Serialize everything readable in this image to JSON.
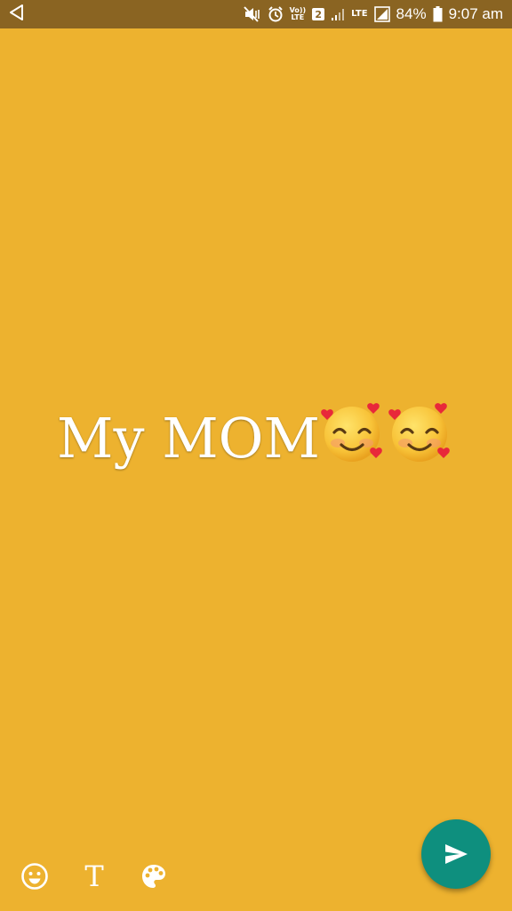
{
  "status_bar": {
    "battery_percent": "84%",
    "battery_level": 84,
    "time": "9:07 am",
    "volte_top": "Vo))",
    "volte_bottom": "LTE",
    "sim_slot": "2",
    "lte_label": "LTE",
    "icons": [
      "back-arrow-icon",
      "mute-vibrate-icon",
      "alarm-icon",
      "volte-icon",
      "sim-2-badge",
      "signal-icon",
      "lte-icon",
      "signal-icon",
      "battery-icon"
    ]
  },
  "composer": {
    "text_part": "My MOM",
    "emoji": "smiling-face-with-hearts",
    "emoji_count": 2,
    "background_color": "#EDB22F"
  },
  "toolbar": {
    "text_tool_label": "T",
    "tools": [
      "emoji-icon",
      "text-style-button",
      "palette-icon"
    ]
  },
  "send": {
    "icon": "send-icon",
    "color": "#0E8F7E"
  }
}
